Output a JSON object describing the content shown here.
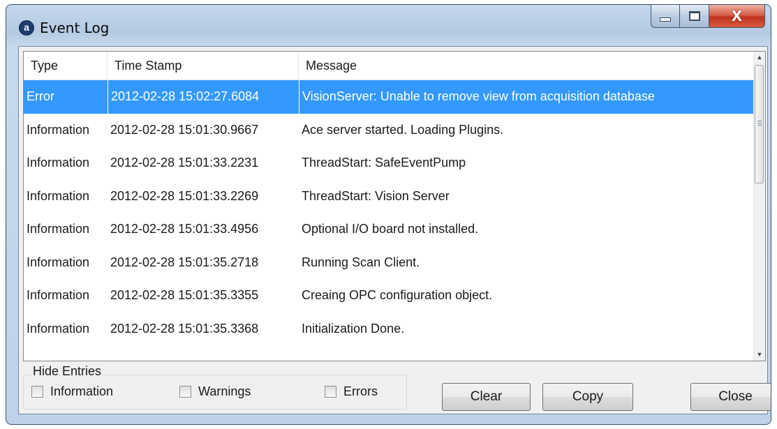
{
  "window": {
    "title": "Event Log",
    "app_icon": "a-logo-icon",
    "minimize_icon": "minimize-icon",
    "maximize_icon": "maximize-icon",
    "close_label": "X"
  },
  "table": {
    "columns": [
      "Type",
      "Time Stamp",
      "Message"
    ],
    "rows": [
      {
        "type": "Error",
        "timestamp": "2012-02-28 15:02:27.6084",
        "message": "VisionServer: Unable to remove view from acquisition database",
        "selected": true
      },
      {
        "type": "Information",
        "timestamp": "2012-02-28 15:01:30.9667",
        "message": "Ace server started. Loading Plugins."
      },
      {
        "type": "Information",
        "timestamp": "2012-02-28 15:01:33.2231",
        "message": "ThreadStart: SafeEventPump"
      },
      {
        "type": "Information",
        "timestamp": "2012-02-28 15:01:33.2269",
        "message": "ThreadStart: Vision Server"
      },
      {
        "type": "Information",
        "timestamp": "2012-02-28 15:01:33.4956",
        "message": "Optional I/O board not installed."
      },
      {
        "type": "Information",
        "timestamp": "2012-02-28 15:01:35.2718",
        "message": "Running Scan Client."
      },
      {
        "type": "Information",
        "timestamp": "2012-02-28 15:01:35.3355",
        "message": "Creaing OPC configuration object."
      },
      {
        "type": "Information",
        "timestamp": "2012-02-28 15:01:35.3368",
        "message": "Initialization Done."
      }
    ],
    "selected_color": "#3399ff"
  },
  "scroll": {
    "up_glyph": "▲",
    "down_glyph": "▼"
  },
  "hide_entries": {
    "legend": "Hide Entries",
    "options": [
      {
        "label": "Information",
        "checked": false
      },
      {
        "label": "Warnings",
        "checked": false
      },
      {
        "label": "Errors",
        "checked": false
      }
    ]
  },
  "buttons": {
    "clear": "Clear",
    "copy": "Copy",
    "close": "Close"
  }
}
